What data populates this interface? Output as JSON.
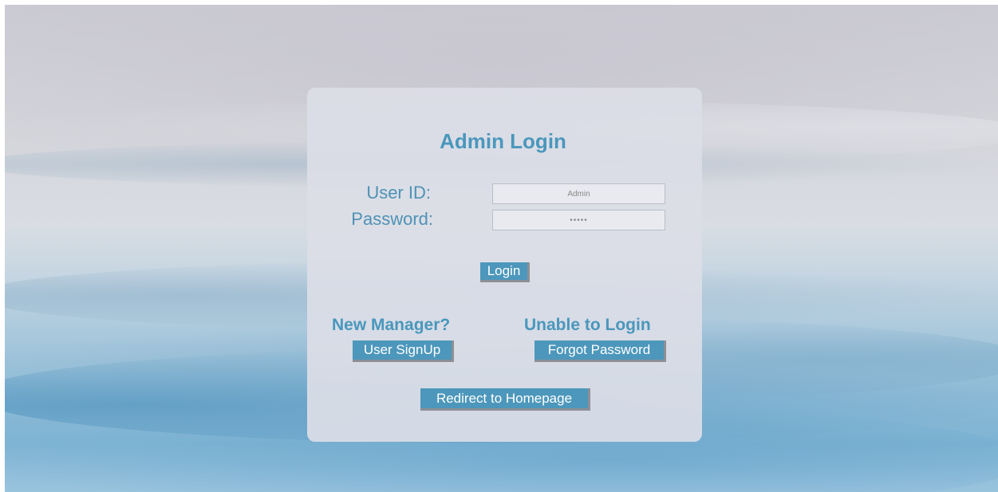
{
  "title": "Admin Login",
  "form": {
    "user_id_label": "User ID:",
    "user_id_value": "Admin",
    "password_label": "Password:",
    "password_value": "•••••",
    "login_label": "Login"
  },
  "signup": {
    "heading": "New Manager?",
    "button_label": "User SignUp"
  },
  "recovery": {
    "heading": "Unable to Login",
    "button_label": "Forgot Password"
  },
  "footer": {
    "home_label": "Redirect to Homepage"
  },
  "colors": {
    "accent": "#4a97bc",
    "card_background": "#dcdee6",
    "button_background": "#4c97bb"
  }
}
